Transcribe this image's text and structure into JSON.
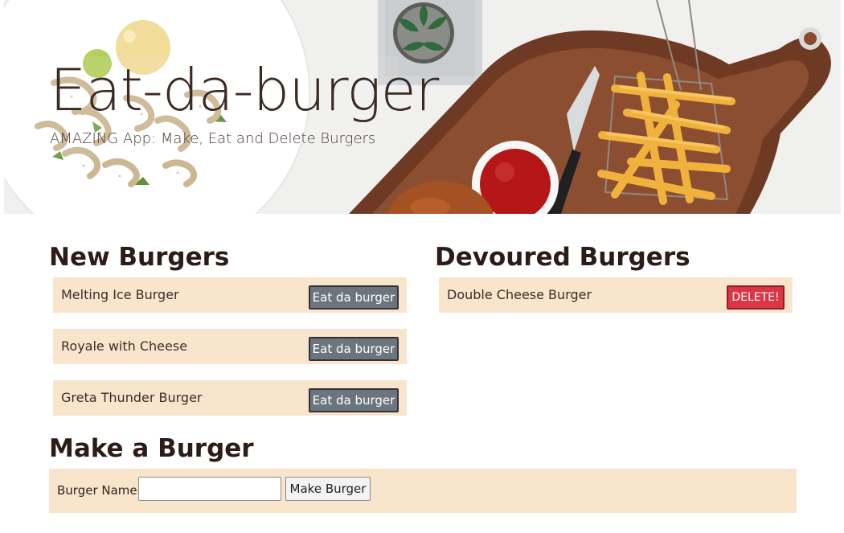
{
  "hero": {
    "title": "Eat-da-burger",
    "subtitle": "AMAZING App: Make, Eat and Delete Burgers"
  },
  "sections": {
    "new_title": "New Burgers",
    "devoured_title": "Devoured Burgers",
    "make_title": "Make a Burger"
  },
  "new_burgers": [
    {
      "name": "Melting Ice Burger",
      "action_label": "Eat da burger"
    },
    {
      "name": "Royale with Cheese",
      "action_label": "Eat da burger"
    },
    {
      "name": "Greta Thunder Burger",
      "action_label": "Eat da burger"
    }
  ],
  "devoured_burgers": [
    {
      "name": "Double Cheese Burger",
      "action_label": "DELETE!"
    }
  ],
  "form": {
    "label": "Burger Name:",
    "input_value": "",
    "button_label": "Make Burger"
  },
  "colors": {
    "row_background": "#f8e5cc",
    "eat_button": "#6c757d",
    "delete_button": "#dc3545",
    "text_dark": "#2c1b17"
  }
}
